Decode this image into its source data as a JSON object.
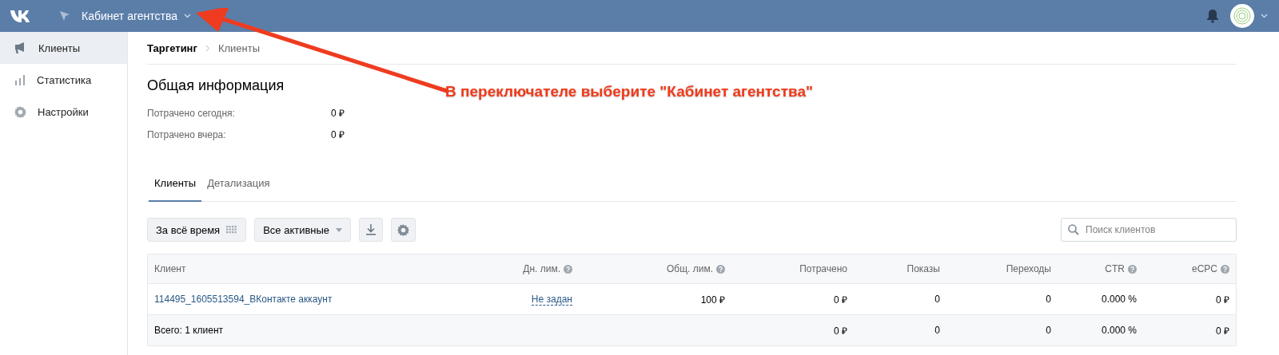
{
  "header": {
    "cabinet": "Кабинет агентства"
  },
  "sidebar": {
    "items": [
      {
        "label": "Клиенты",
        "selected": true
      },
      {
        "label": "Статистика",
        "selected": false
      },
      {
        "label": "Настройки",
        "selected": false
      }
    ]
  },
  "breadcrumbs": [
    "Таргетинг",
    "Клиенты"
  ],
  "summary": {
    "title": "Общая информация",
    "rows": [
      {
        "label": "Потрачено сегодня:",
        "value": "0 ₽"
      },
      {
        "label": "Потрачено вчера:",
        "value": "0 ₽"
      }
    ]
  },
  "tabs": [
    {
      "label": "Клиенты",
      "selected": true
    },
    {
      "label": "Детализация",
      "selected": false
    }
  ],
  "toolbar": {
    "period": "За всё время",
    "filter": "Все активные",
    "search": {
      "placeholder": "Поиск клиентов"
    }
  },
  "table": {
    "columns": [
      {
        "label": "Клиент",
        "help": false
      },
      {
        "label": "Дн. лим.",
        "help": true
      },
      {
        "label": "Общ. лим.",
        "help": true
      },
      {
        "label": "Потрачено",
        "help": false
      },
      {
        "label": "Показы",
        "help": false
      },
      {
        "label": "Переходы",
        "help": false
      },
      {
        "label": "CTR",
        "help": true
      },
      {
        "label": "eCPC",
        "help": true
      }
    ],
    "rows": [
      {
        "cells": [
          "114495_1605513594_ВКонтакте аккаунт",
          "Не задан",
          "100 ₽",
          "0 ₽",
          "0",
          "0",
          "0.000 %",
          "0 ₽"
        ]
      }
    ],
    "total": {
      "label": "Всего: 1 клиент",
      "spent": "0 ₽",
      "impressions": "0",
      "clicks": "0",
      "ctr": "0.000 %",
      "ecpc": "0 ₽"
    }
  },
  "annotation": {
    "text": "В переключателе выберите \"Кабинет агентства\""
  }
}
